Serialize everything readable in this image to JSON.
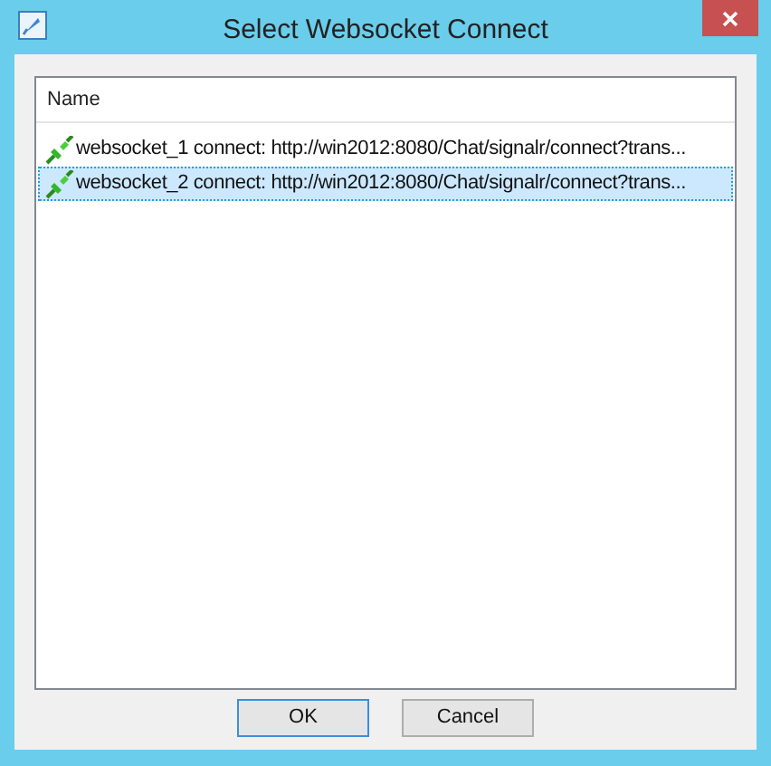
{
  "window": {
    "title": "Select Websocket Connect"
  },
  "list": {
    "columns": [
      "Name"
    ],
    "rows": [
      {
        "text": "websocket_1 connect: http://win2012:8080/Chat/signalr/connect?trans...",
        "selected": false
      },
      {
        "text": "websocket_2 connect: http://win2012:8080/Chat/signalr/connect?trans...",
        "selected": true
      }
    ]
  },
  "buttons": [
    {
      "label": "OK",
      "default": true
    },
    {
      "label": "Cancel",
      "default": false
    }
  ]
}
